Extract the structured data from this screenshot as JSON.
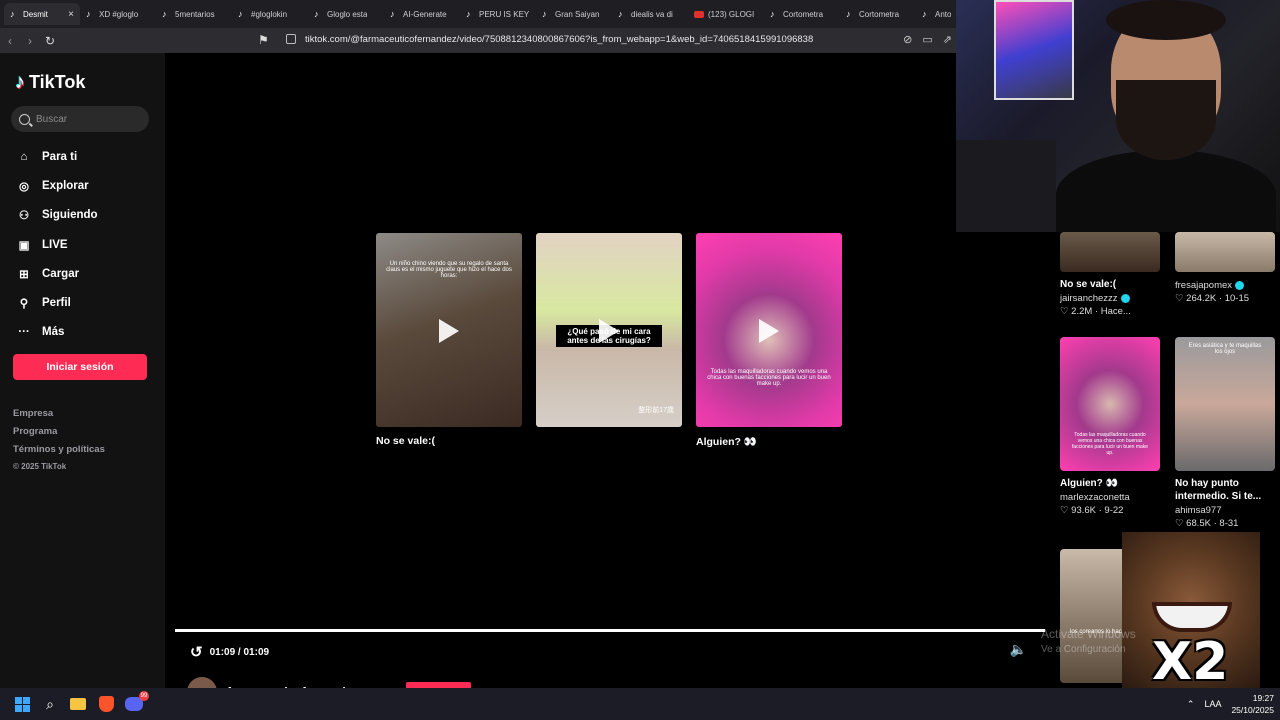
{
  "browser": {
    "tabs": [
      {
        "title": "Desmit",
        "active": true
      },
      {
        "title": "XD #gloglo"
      },
      {
        "title": "5mentarios"
      },
      {
        "title": "#gloglokin"
      },
      {
        "title": "Gloglo esta"
      },
      {
        "title": "AI-Generate"
      },
      {
        "title": "PERU IS KEY"
      },
      {
        "title": "Gran Saiyan"
      },
      {
        "title": "diealis va di"
      },
      {
        "title": "(123) GLOGI",
        "youtube": true
      },
      {
        "title": "Cortometra"
      },
      {
        "title": "Cortometra"
      },
      {
        "title": "Anto"
      }
    ],
    "url": "tiktok.com/@farmaceuticofernandez/video/7508812340800867606?is_from_webapp=1&web_id=7406518415991096838"
  },
  "sidebar": {
    "logo": "TikTok",
    "search_placeholder": "Buscar",
    "nav": [
      {
        "label": "Para ti",
        "icon": "home-icon"
      },
      {
        "label": "Explorar",
        "icon": "compass-icon"
      },
      {
        "label": "Siguiendo",
        "icon": "following-icon"
      },
      {
        "label": "LIVE",
        "icon": "live-icon"
      },
      {
        "label": "Cargar",
        "icon": "upload-icon"
      },
      {
        "label": "Perfil",
        "icon": "profile-icon"
      },
      {
        "label": "Más",
        "icon": "more-icon"
      }
    ],
    "login_label": "Iniciar sesión",
    "footer": [
      "Empresa",
      "Programa",
      "Términos y políticas"
    ],
    "copyright": "© 2025 TikTok"
  },
  "player": {
    "recommendations": [
      {
        "title": "No se vale:(",
        "overlay": "Un niño chino viendo que su regalo de santa claus es el mismo juguete que hizo el hace dos horas:"
      },
      {
        "title": "",
        "overlay": "¿Qué pasó de mi cara antes de las cirugías?",
        "note": "整形前17歲"
      },
      {
        "title": "Alguien? 👀",
        "overlay": "Todas las maquilladoras cuando vemos una chica con buenas facciones para lucir un buen make up."
      }
    ],
    "time": "01:09 / 01:09",
    "progress": 1.0,
    "author": "farmaceuticofernandez"
  },
  "feed": [
    {
      "title": "No se vale:(",
      "user": "jairsanchezzz",
      "verified": true,
      "meta": "♡ 2.2M · Hace..."
    },
    {
      "title": "",
      "user": "fresajapomex",
      "verified": true,
      "meta": "♡ 264.2K · 10-15"
    },
    {
      "title": "Alguien? 👀",
      "user": "marlexzaconetta",
      "verified": false,
      "meta": "♡ 93.6K · 9-22",
      "overlay": "Todas las maquilladoras cuando vemos una chica con buenas facciones para lucir un buen make up."
    },
    {
      "title": "No hay punto intermedio. Si te...",
      "user": "ahimsa977",
      "verified": false,
      "meta": "♡ 68.5K · 8-31",
      "overlay": "Eres asiática y te maquillas los ojos"
    },
    {
      "title": "",
      "user": "",
      "overlay": "los coreanos lo hacia arri"
    }
  ],
  "overlay": {
    "meme_text": "X2",
    "watermark_title": "Activate Windows",
    "watermark_sub": "Ve a Configuración"
  },
  "taskbar": {
    "lang": "LAA",
    "time": "19:27",
    "date": "25/10/2025",
    "discord_badge": "99"
  }
}
